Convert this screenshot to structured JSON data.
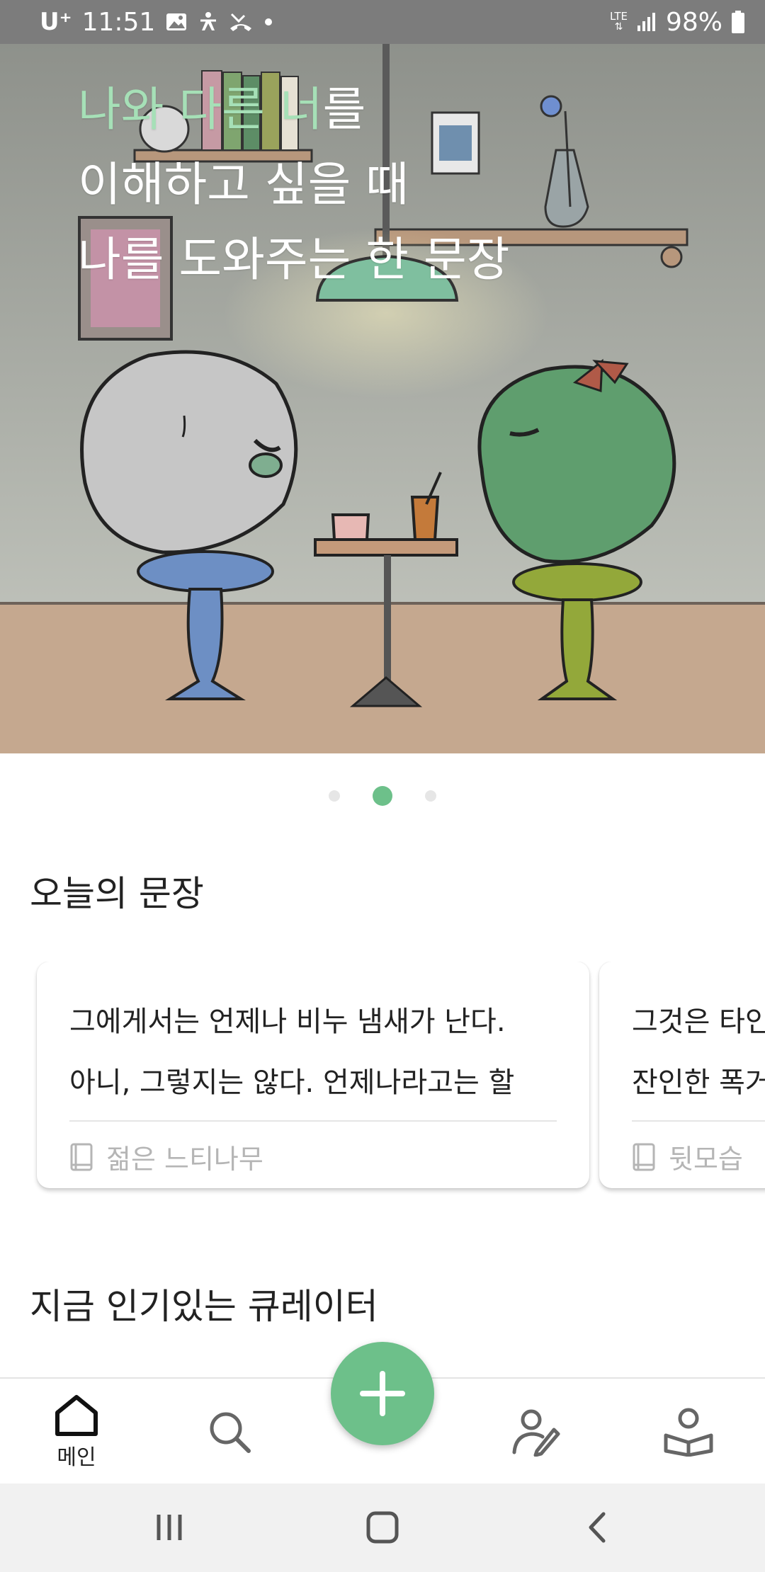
{
  "status_bar": {
    "carrier": "U⁺",
    "time": "11:51",
    "network": "LTE",
    "battery": "98%"
  },
  "hero": {
    "line1_accent": "나와 다른 너",
    "line1_rest": "를",
    "line2": "이해하고 싶을 때",
    "line3": "나를 도와주는 한 문장",
    "page_index": 2,
    "page_count": 3
  },
  "today": {
    "title": "오늘의 문장",
    "cards": [
      {
        "line1": "그에게서는 언제나 비누 냄새가 난다.",
        "line2": "아니, 그렇지는 않다. 언제나라고는 할",
        "book": "젊은 느티나무"
      },
      {
        "line1": "그것은 타인",
        "line2": "잔인한 폭거",
        "book": "뒷모습"
      }
    ]
  },
  "popular": {
    "title": "지금 인기있는 큐레이터"
  },
  "bottom_nav": {
    "home_label": "메인",
    "icons": [
      "home-icon",
      "search-icon",
      "curator-icon",
      "reader-icon"
    ],
    "fab_icon": "plus-icon"
  },
  "colors": {
    "accent": "#6dc08a",
    "hero_accent_text": "#a6e0b7"
  }
}
